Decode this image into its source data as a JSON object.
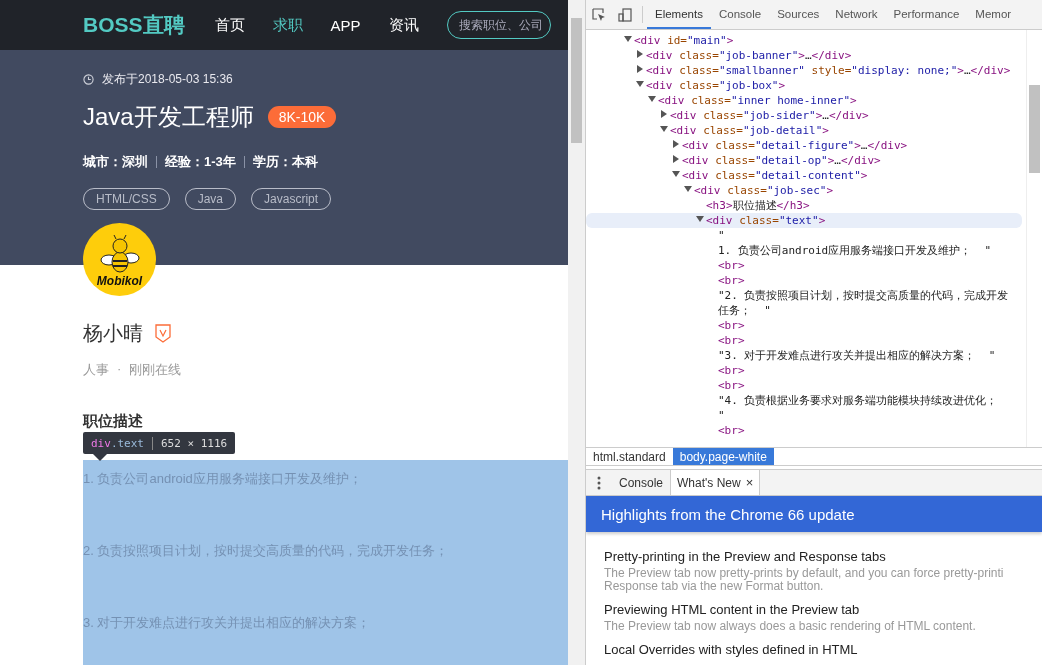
{
  "page": {
    "header": {
      "logo": "BOSS直聘",
      "nav": [
        {
          "label": "首页",
          "selected": false
        },
        {
          "label": "求职",
          "selected": true
        },
        {
          "label": "APP",
          "selected": false
        },
        {
          "label": "资讯",
          "selected": false
        }
      ],
      "search": {
        "placeholder": "搜索职位、公司"
      }
    },
    "job": {
      "published": "发布于2018-05-03 15:36",
      "title": "Java开发工程师",
      "salary": "8K-10K",
      "facts": [
        "城市：深圳",
        "经验：1-3年",
        "学历：本科"
      ],
      "tags": [
        "HTML/CSS",
        "Java",
        "Javascript"
      ]
    },
    "recruiter": {
      "logo_text": "Mobikol",
      "name": "杨小晴",
      "verified": true,
      "role": "人事",
      "separator": "·",
      "status": "刚刚在线"
    },
    "description": {
      "heading": "职位描述",
      "highlighted": true,
      "items": [
        "1. 负责公司android应用服务端接口开发及维护；",
        "2. 负责按照项目计划，按时提交高质量的代码，完成开发任务；",
        "3. 对于开发难点进行攻关并提出相应的解决方案；"
      ]
    },
    "inspect_tooltip": {
      "selector": "div.text",
      "size": "652 × 1116"
    }
  },
  "devtools": {
    "tabs": [
      {
        "label": "Elements",
        "selected": true
      },
      {
        "label": "Console",
        "selected": false
      },
      {
        "label": "Sources",
        "selected": false
      },
      {
        "label": "Network",
        "selected": false
      },
      {
        "label": "Performance",
        "selected": false
      },
      {
        "label": "Memor",
        "selected": false
      }
    ],
    "dom_tree": [
      {
        "kind": "element",
        "markup": "<div id=\"main\">",
        "expanded": true,
        "selected": false,
        "children": [
          {
            "kind": "element",
            "markup": "<div class=\"job-banner\">…</div>",
            "expanded": false,
            "selected": false
          },
          {
            "kind": "element",
            "markup": "<div class=\"smallbanner\" style=\"display: none;\">…</div>",
            "expanded": false,
            "selected": false
          },
          {
            "kind": "element",
            "markup": "<div class=\"job-box\">",
            "expanded": true,
            "selected": false,
            "children": [
              {
                "kind": "element",
                "markup": "<div class=\"inner home-inner\">",
                "expanded": true,
                "selected": false,
                "children": [
                  {
                    "kind": "element",
                    "markup": "<div class=\"job-sider\">…</div>",
                    "expanded": false,
                    "selected": false
                  },
                  {
                    "kind": "element",
                    "markup": "<div class=\"job-detail\">",
                    "expanded": true,
                    "selected": false,
                    "children": [
                      {
                        "kind": "element",
                        "markup": "<div class=\"detail-figure\">…</div>",
                        "expanded": false,
                        "selected": false
                      },
                      {
                        "kind": "element",
                        "markup": "<div class=\"detail-op\">…</div>",
                        "expanded": false,
                        "selected": false
                      },
                      {
                        "kind": "element",
                        "markup": "<div class=\"detail-content\">",
                        "expanded": true,
                        "selected": false,
                        "children": [
                          {
                            "kind": "element",
                            "markup": "<div class=\"job-sec\">",
                            "expanded": true,
                            "selected": false,
                            "children": [
                              {
                                "kind": "leaf",
                                "markup": "<h3>职位描述</h3>",
                                "selected": false
                              },
                              {
                                "kind": "element",
                                "markup": "<div class=\"text\">",
                                "expanded": true,
                                "selected": true,
                                "children": [
                                  {
                                    "kind": "text",
                                    "markup": "\"\n1. 负责公司android应用服务端接口开发及维护；  \"",
                                    "selected": false
                                  },
                                  {
                                    "kind": "leaf",
                                    "markup": "<br>",
                                    "selected": false
                                  },
                                  {
                                    "kind": "leaf",
                                    "markup": "<br>",
                                    "selected": false
                                  },
                                  {
                                    "kind": "text",
                                    "markup": "\"2. 负责按照项目计划，按时提交高质量的代码，完成开发任务；  \"",
                                    "selected": false
                                  },
                                  {
                                    "kind": "leaf",
                                    "markup": "<br>",
                                    "selected": false
                                  },
                                  {
                                    "kind": "leaf",
                                    "markup": "<br>",
                                    "selected": false
                                  },
                                  {
                                    "kind": "text",
                                    "markup": "\"3. 对于开发难点进行攻关并提出相应的解决方案；  \"",
                                    "selected": false
                                  },
                                  {
                                    "kind": "leaf",
                                    "markup": "<br>",
                                    "selected": false
                                  },
                                  {
                                    "kind": "leaf",
                                    "markup": "<br>",
                                    "selected": false
                                  },
                                  {
                                    "kind": "text",
                                    "markup": "\"4. 负责根据业务要求对服务端功能模块持续改进优化；  \"",
                                    "selected": false
                                  },
                                  {
                                    "kind": "leaf",
                                    "markup": "<br>",
                                    "selected": false
                                  }
                                ]
                              }
                            ]
                          }
                        ]
                      }
                    ]
                  }
                ]
              }
            ]
          }
        ]
      }
    ],
    "breadcrumbs": [
      {
        "label": "html.standard",
        "selected": false
      },
      {
        "label": "body.page-white",
        "selected": true
      }
    ],
    "drawer": {
      "tabs": [
        {
          "label": "Console",
          "selected": false,
          "closable": false
        },
        {
          "label": "What's New",
          "selected": true,
          "closable": true,
          "close": "×"
        }
      ],
      "banner": "Highlights from the Chrome 66 update",
      "items": [
        {
          "title": "Pretty-printing in the Preview and Response tabs",
          "description_lines": [
            "The Preview tab now pretty-prints by default, and you can force pretty-printi",
            "Response tab via the new Format button."
          ]
        },
        {
          "title": "Previewing HTML content in the Preview tab",
          "description_lines": [
            "The Preview tab now always does a basic rendering of HTML content."
          ]
        },
        {
          "title": "Local Overrides with styles defined in HTML"
        }
      ]
    }
  }
}
